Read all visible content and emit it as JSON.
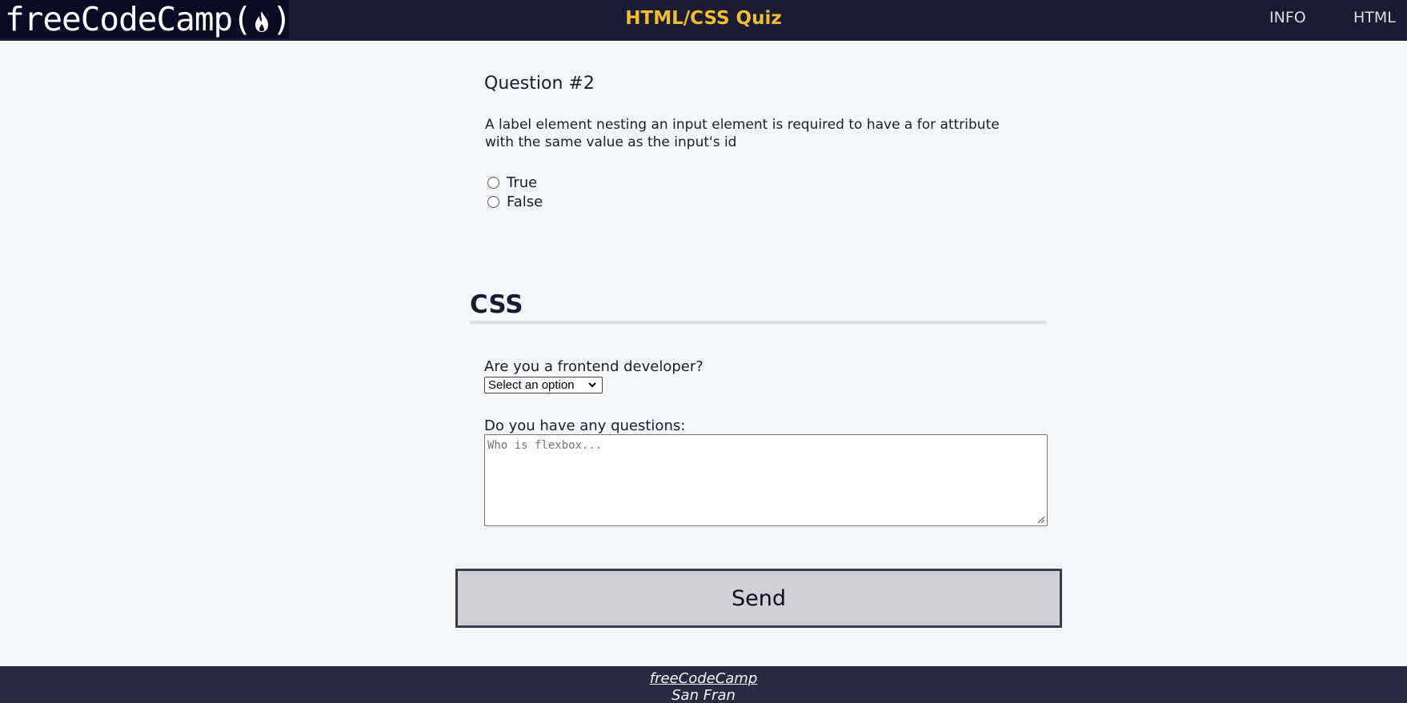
{
  "header": {
    "logo_text_left": "freeCodeCamp(",
    "logo_text_right": ")",
    "title": "HTML/CSS Quiz",
    "nav": [
      {
        "label": "INFO"
      },
      {
        "label": "HTML"
      }
    ]
  },
  "question": {
    "number_label": "Question #2",
    "text": "A label element nesting an input element is required to have a for attribute with the same value as the input's id",
    "options": [
      {
        "label": "True",
        "selected": false
      },
      {
        "label": "False",
        "selected": false
      }
    ]
  },
  "css_section": {
    "title": "CSS",
    "frontend_label": "Are you a frontend developer?",
    "frontend_select_value": "Select an option",
    "questions_label": "Do you have any questions:",
    "questions_placeholder": "Who is flexbox..."
  },
  "submit": {
    "label": "Send"
  },
  "footer": {
    "link": "freeCodeCamp",
    "address": "San Fran"
  },
  "colors": {
    "header_bg": "#1b1b32",
    "logo_bg": "#0a0a23",
    "title_accent": "#f1be32",
    "page_bg": "#f5f6f7",
    "button_bg": "#d0d0d5",
    "footer_bg": "#2a2a40"
  }
}
